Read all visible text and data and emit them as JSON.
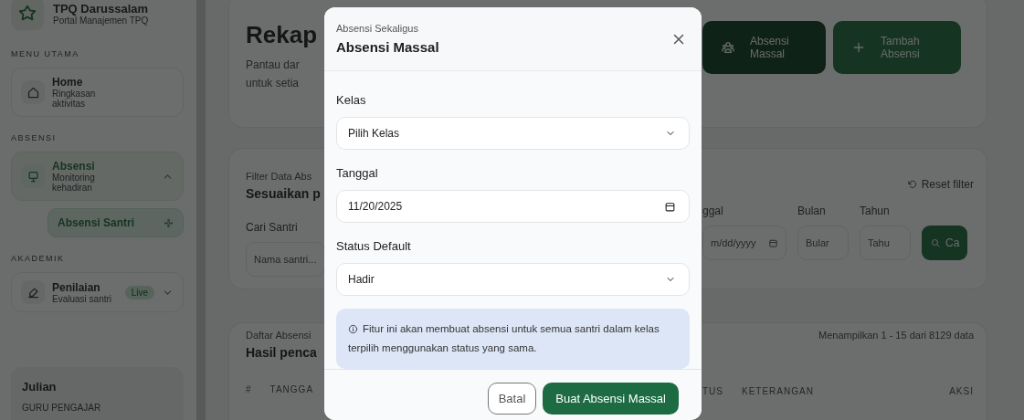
{
  "sidebar": {
    "brand": {
      "title": "TPQ Darussalam",
      "subtitle": "Portal Manajemen TPQ"
    },
    "sections": [
      {
        "heading": "MENU UTAMA",
        "items": [
          {
            "kind": "link",
            "label": "Home",
            "caption": "Ringkasan aktivitas",
            "selected": false
          }
        ]
      },
      {
        "heading": "ABSENSI",
        "items": [
          {
            "kind": "group",
            "label": "Absensi",
            "caption": "Monitoring kehadiran",
            "selected": true,
            "expanded": true,
            "children": [
              {
                "label": "Absensi Santri",
                "selected": true
              }
            ]
          }
        ]
      },
      {
        "heading": "AKADEMIK",
        "items": [
          {
            "kind": "group",
            "label": "Penilaian",
            "caption": "Evaluasi santri",
            "badge": "Live",
            "selected": false,
            "expanded": false
          }
        ]
      }
    ],
    "user": {
      "name": "Julian",
      "role": "GURU PENGAJAR"
    }
  },
  "main": {
    "header": {
      "title": "Rekap",
      "description_lines": [
        "Pantau dar",
        "untuk setia"
      ],
      "actions": [
        {
          "kind": "dark",
          "label": "Absensi Massal"
        },
        {
          "kind": "primary",
          "label": "Tambah Absensi"
        }
      ]
    },
    "filter": {
      "eyebrow": "Filter Data Abs",
      "title": "Sesuaikan p",
      "reset": "Reset filter",
      "fields": [
        {
          "kind": "text",
          "label": "Cari Santri",
          "placeholder": "Nama santri..."
        },
        {
          "kind": "date",
          "label": "ggal",
          "placeholder": "m/dd/yyyy"
        },
        {
          "kind": "text",
          "label": "Bulan",
          "placeholder": "Bular"
        },
        {
          "kind": "text",
          "label": "Tahun",
          "placeholder": "Tahu"
        }
      ],
      "search_button": "Ca"
    },
    "table": {
      "eyebrow": "Daftar Absensi",
      "title": "Hasil penca",
      "summary": "Menampilkan 1 - 15 dari 8129 data",
      "columns": [
        "#",
        "TANGGA",
        "TUS",
        "KETERANGAN",
        "AKSI"
      ]
    }
  },
  "modal": {
    "eyebrow": "Absensi Sekaligus",
    "title": "Absensi Massal",
    "fields": [
      {
        "kind": "select",
        "label": "Kelas",
        "value": "Pilih Kelas"
      },
      {
        "kind": "date",
        "label": "Tanggal",
        "value": "11/20/2025"
      },
      {
        "kind": "select",
        "label": "Status Default",
        "value": "Hadir"
      }
    ],
    "info": "Fitur ini akan membuat absensi untuk semua santri dalam kelas terpilih menggunakan status yang sama.",
    "buttons": [
      {
        "kind": "secondary",
        "label": "Batal"
      },
      {
        "kind": "primary",
        "label": "Buat Absensi Massal"
      }
    ]
  }
}
